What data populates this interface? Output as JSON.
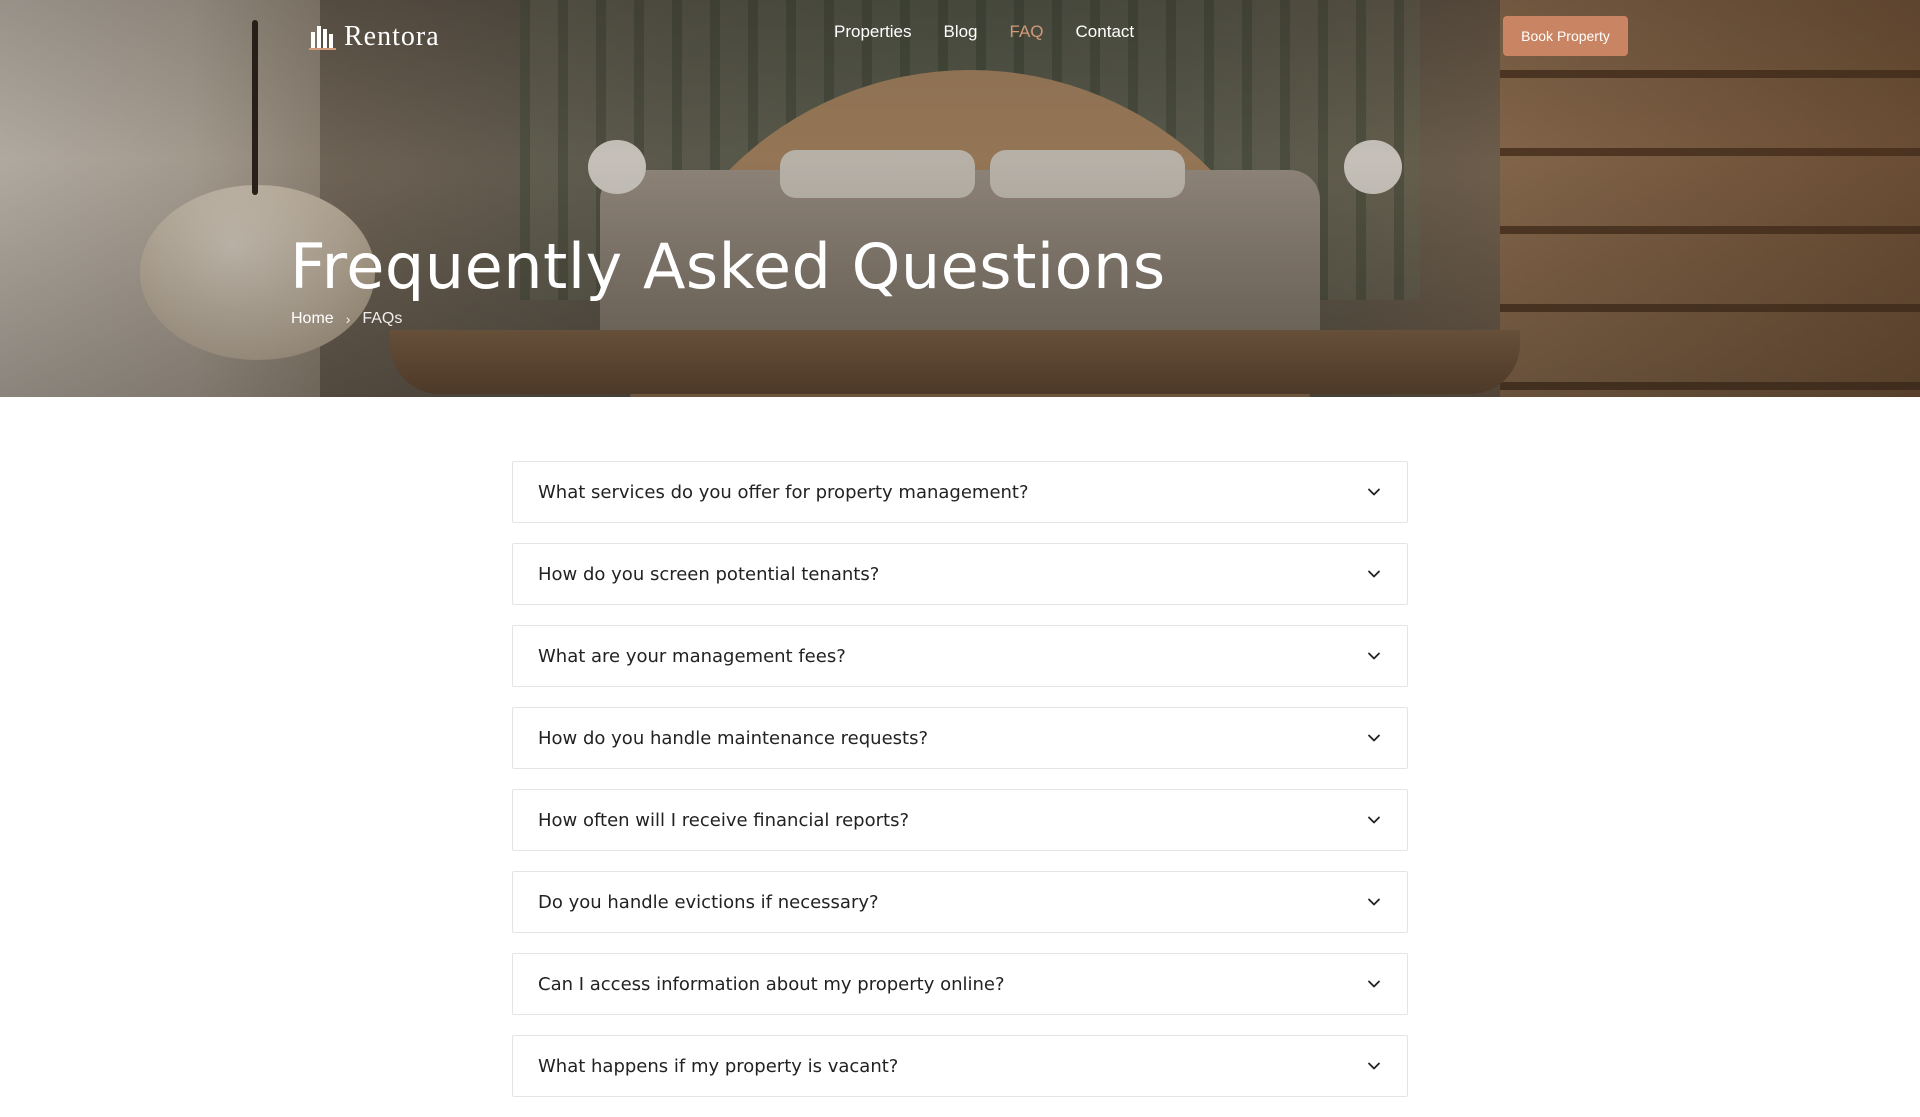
{
  "brand": {
    "name": "Rentora",
    "logo_icon": "buildings-logo-icon"
  },
  "nav": {
    "links": [
      {
        "label": "Properties",
        "active": false
      },
      {
        "label": "Blog",
        "active": false
      },
      {
        "label": "FAQ",
        "active": true
      },
      {
        "label": "Contact",
        "active": false
      }
    ],
    "cta_label": "Book Property"
  },
  "hero": {
    "title": "Frequently Asked Questions",
    "breadcrumb": {
      "home": "Home",
      "separator": "›",
      "current": "FAQs"
    }
  },
  "faq": {
    "items": [
      {
        "question": "What services do you offer for property management?",
        "expanded": false
      },
      {
        "question": "How do you screen potential tenants?",
        "expanded": false
      },
      {
        "question": "What are your management fees?",
        "expanded": false
      },
      {
        "question": "How do you handle maintenance requests?",
        "expanded": false
      },
      {
        "question": "How often will I receive financial reports?",
        "expanded": false
      },
      {
        "question": "Do you handle evictions if necessary?",
        "expanded": false
      },
      {
        "question": "Can I access information about my property online?",
        "expanded": false
      },
      {
        "question": "What happens if my property is vacant?",
        "expanded": false
      }
    ],
    "toggle_icon": "chevron-down-icon"
  },
  "colors": {
    "accent": "#c98563",
    "nav_active": "#d29a78",
    "text": "#222222",
    "border": "#e4e4e4"
  }
}
